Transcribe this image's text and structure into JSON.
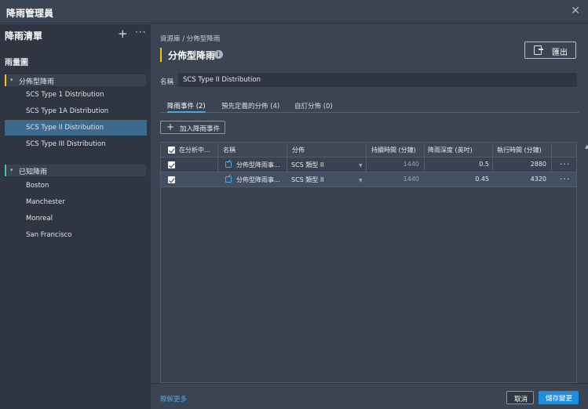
{
  "window": {
    "title": "降雨管理員",
    "close_glyph": "✕"
  },
  "sidebar": {
    "title": "降雨清單",
    "add_glyph": "+",
    "more_glyph": "···",
    "subtitle": "雨量圖",
    "groups": [
      {
        "label": "分佈型降雨",
        "accent": "#f5c518",
        "items": [
          {
            "label": "SCS Type 1 Distribution"
          },
          {
            "label": "SCS Type 1A Distribution"
          },
          {
            "label": "SCS Type II Distribution",
            "selected": true
          },
          {
            "label": "SCS Type III Distribution"
          }
        ]
      },
      {
        "label": "已知降雨",
        "accent": "#3ec99a",
        "items": [
          {
            "label": "Boston"
          },
          {
            "label": "Manchester"
          },
          {
            "label": "Monreal"
          },
          {
            "label": "San Francisco"
          }
        ]
      }
    ],
    "chevron_glyph": "▾"
  },
  "main": {
    "breadcrumb": "資源庫 / 分佈型降雨",
    "title": "分佈型降雨",
    "info_glyph": "i",
    "export_label": "匯出",
    "name_label": "名稱",
    "name_value": "SCS Type II Distribution",
    "tabs": [
      {
        "label": "降雨事件 (2)",
        "active": true
      },
      {
        "label": "預先定義的分佈 (4)"
      },
      {
        "label": "自訂分佈 (0)"
      }
    ],
    "add_event_label": "加入降雨事件",
    "add_glyph": "+",
    "table": {
      "headers": [
        "在分析中...",
        "名稱",
        "分佈",
        "持續時間 (分鐘)",
        "降雨深度 (英吋)",
        "執行時間 (分鐘)"
      ],
      "rows": [
        {
          "in_analysis": true,
          "name": "分佈型降雨事...",
          "distribution": "SCS 類型 II",
          "duration": "1440",
          "depth": "0.5",
          "run_time": "2880"
        },
        {
          "in_analysis": true,
          "name": "分佈型降雨事...",
          "distribution": "SCS 類型 II",
          "duration": "1440",
          "depth": "0.45",
          "run_time": "4320"
        }
      ],
      "row_more_glyph": "···",
      "dropdown_glyph": "▼"
    },
    "scroll_up_glyph": "▲",
    "footer": {
      "learn_more": "瞭解更多",
      "cancel_label": "取消",
      "save_label": "儲存變更"
    }
  },
  "colors": {
    "accent_blue": "#1f8de0",
    "link_blue": "#4ea3e0",
    "selected_row": "#3b6a8c",
    "panel_bg": "#3b4453",
    "sidebar_bg": "#2f3642"
  }
}
